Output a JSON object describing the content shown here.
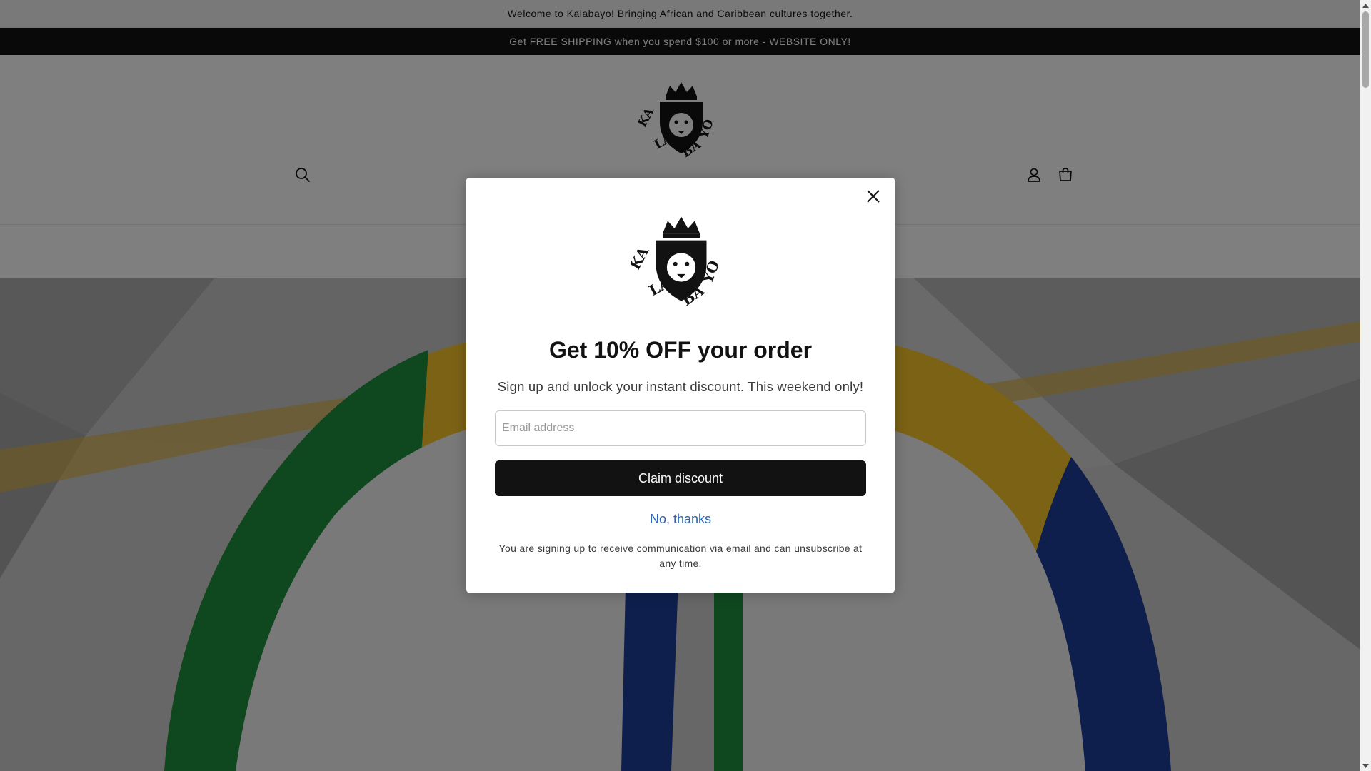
{
  "announcement": {
    "welcome": "Welcome to Kalabayo! Bringing African and Caribbean cultures together.",
    "shipping": "Get FREE SHIPPING when you spend $100 or more - WEBSITE ONLY!"
  },
  "header": {
    "logo_text": "KALA BAYO",
    "icons": {
      "search": "search-icon",
      "account": "account-icon",
      "cart": "cart-icon"
    }
  },
  "popup": {
    "logo_text": "KALA BAYO",
    "title": "Get 10% OFF your order",
    "subtitle": "Sign up and unlock your instant discount. This weekend only!",
    "email_placeholder": "Email address",
    "email_value": "",
    "claim_label": "Claim discount",
    "decline_label": "No, thanks",
    "legal_text": "You are signing up to receive communication via email and can unsubscribe at any time.",
    "close_icon": "close-icon"
  },
  "colors": {
    "announcement_bar": "#121212",
    "button": "#121212",
    "decline_link": "#2a62b0",
    "sandal_green": "#1a8a3a",
    "sandal_yellow": "#f0c419",
    "sandal_blue": "#1f3f9a"
  }
}
